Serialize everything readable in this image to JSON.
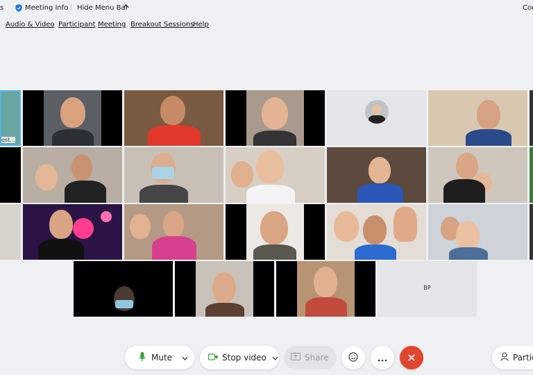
{
  "topbar": {
    "left_fragment": "s",
    "meeting_info": "Meeting Info",
    "hide_menu": "Hide Menu Bar",
    "right_fragment": "Cor"
  },
  "menubar": {
    "items": [
      "Audio & Video",
      "Participant",
      "Meeting",
      "Breakout Sessions",
      "Help"
    ]
  },
  "tiles": {
    "partial_label": "ost...",
    "bp_initials": "BP"
  },
  "controls": {
    "mute": "Mute",
    "stop_video": "Stop video",
    "share": "Share",
    "participants": "Partici"
  },
  "colors": {
    "mute_icon": "#2e9e3a",
    "end_call": "#e0452f",
    "share_text": "#9aa0a6",
    "accent": "#1a73e8"
  }
}
